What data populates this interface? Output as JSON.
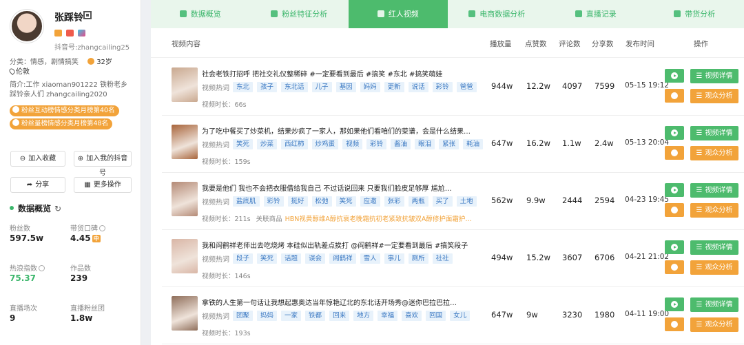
{
  "profile": {
    "name": "张踩铃",
    "douyin_id": "抖音号:zhangcailing25",
    "category": "分类：情感，剧情搞笑",
    "fans_short": "32岁",
    "location": "伦敦",
    "intro": "简介:工作 xiaoman901222 铁粉老乡踩铃亲人们 zhangcailing2020",
    "ranks": [
      "粉丝互动榜情感分类月榜第40名",
      "粉丝量榜情感分类月榜第48名"
    ],
    "buttons": {
      "collect": "加入收藏",
      "add_mine": "加入我的抖音号",
      "share": "分享",
      "more": "更多操作"
    }
  },
  "overview": {
    "title": "数据概览",
    "stats": [
      {
        "label": "粉丝数",
        "value": "597.5w"
      },
      {
        "label": "带货口碑",
        "value": "4.45",
        "badge": "中"
      },
      {
        "label": "热浪指数",
        "value": "75.37"
      },
      {
        "label": "作品数",
        "value": "239"
      },
      {
        "label": "直播场次",
        "value": "9"
      },
      {
        "label": "直播粉丝团",
        "value": "1.8w"
      }
    ]
  },
  "tabs": [
    {
      "label": "数据概览",
      "active": false
    },
    {
      "label": "粉丝特征分析",
      "active": false
    },
    {
      "label": "红人视频",
      "active": true
    },
    {
      "label": "电商数据分析",
      "active": false
    },
    {
      "label": "直播记录",
      "active": false
    },
    {
      "label": "带货分析",
      "active": false
    }
  ],
  "table": {
    "headers": [
      "视频内容",
      "播放量",
      "点赞数",
      "评论数",
      "分享数",
      "发布时间",
      "操作"
    ],
    "tag_label": "视频热词",
    "dur_label": "视频时长：",
    "goods_label": "关联商品",
    "detail_btn": "视频详情",
    "audience_btn": "观众分析",
    "rows": [
      {
        "title": "社会老铁打招呼 把社交礼仪整稀碎 #一定要看到最后 #搞笑 #东北 #搞笑萌娃",
        "tags": [
          "东北",
          "孩子",
          "东北话",
          "儿子",
          "基因",
          "妈妈",
          "更新",
          "说话",
          "彩铃",
          "爸爸"
        ],
        "duration": "66s",
        "goods": "",
        "plays": "944w",
        "likes": "12.2w",
        "comments": "4097",
        "shares": "7599",
        "date": "05-15 19:12",
        "thumb_color": "#c9a88f"
      },
      {
        "title": "为了吃中餐买了炒菜机，结果炒疯了一家人，那如果他们看咱们的菜谱，会是什么结果…",
        "tags": [
          "笑死",
          "炒菜",
          "西红柿",
          "炒鸡蛋",
          "视频",
          "彩铃",
          "酱油",
          "眼泪",
          "紧张",
          "耗油"
        ],
        "duration": "159s",
        "goods": "",
        "plays": "647w",
        "likes": "16.2w",
        "comments": "1.1w",
        "shares": "2.4w",
        "date": "05-13 20:04",
        "thumb_color": "#a8643a"
      },
      {
        "title": "我要是他们 我也不会把衣服借给我自己 不过话说回来 只要我们脸皮足够厚 尴尬…",
        "tags": [
          "盐底肌",
          "彩铃",
          "挺好",
          "松弛",
          "笑死",
          "应邀",
          "张彩",
          "两瓶",
          "买了",
          "土地"
        ],
        "duration": "211s",
        "goods": "HBN视黄醇维A醇抗衰老晚霜抗初老紧致抗皱双A醇修护面霜护…",
        "plays": "562w",
        "likes": "9.9w",
        "comments": "2444",
        "shares": "2594",
        "date": "04-23 19:45",
        "thumb_color": "#b48a76"
      },
      {
        "title": "我和阎鹤祥老师出去吃烧烤 本硅似出轨差点挨打 @阎鹤祥#一定要看到最后 #搞笑段子",
        "tags": [
          "段子",
          "笑死",
          "话题",
          "误会",
          "阎鹤祥",
          "雪人",
          "事儿",
          "厕所",
          "社社"
        ],
        "duration": "146s",
        "goods": "",
        "plays": "494w",
        "likes": "15.2w",
        "comments": "3607",
        "shares": "6706",
        "date": "04-21 21:02",
        "thumb_color": "#d9b6a6"
      },
      {
        "title": "拿铁的人生第一句话让我想起惠奥达当年惊艳辽北的东北话开场秀@迷你巴拉巴拉…",
        "tags": [
          "团聚",
          "妈妈",
          "一家",
          "铁都",
          "回来",
          "地方",
          "幸福",
          "喜欢",
          "回国",
          "女儿"
        ],
        "duration": "193s",
        "goods": "",
        "plays": "647w",
        "likes": "9w",
        "comments": "3230",
        "shares": "1980",
        "date": "04-11 19:00",
        "thumb_color": "#8f6e5a"
      }
    ]
  }
}
